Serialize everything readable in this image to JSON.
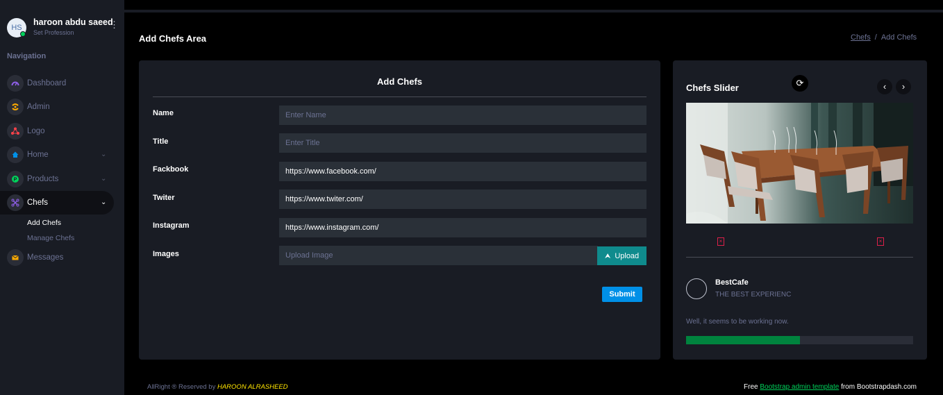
{
  "profile": {
    "initials": "HS",
    "name": "haroon abdu saeed",
    "role": "Set Profession"
  },
  "sidebar": {
    "heading": "Navigation",
    "items": [
      {
        "label": "Dashboard",
        "icon": "speedometer-icon",
        "color": "#8f5fe8"
      },
      {
        "label": "Admin",
        "icon": "admin-icon",
        "color": "#ffab00"
      },
      {
        "label": "Logo",
        "icon": "logo-icon",
        "color": "#fc424a"
      },
      {
        "label": "Home",
        "icon": "home-icon",
        "color": "#0090e7",
        "arrow": "⌄"
      },
      {
        "label": "Products",
        "icon": "products-icon",
        "color": "#00d25b",
        "arrow": "⌄"
      },
      {
        "label": "Chefs",
        "icon": "chefs-icon",
        "color": "#8f5fe8",
        "arrow": "⌄"
      },
      {
        "label": "Messages",
        "icon": "mail-icon",
        "color": "#ffab00"
      }
    ],
    "subitems": [
      "Add Chefs",
      "Manage Chefs"
    ]
  },
  "header": {
    "title": "Add Chefs Area",
    "breadcrumb_link": "Chefs",
    "breadcrumb_sep": "/",
    "breadcrumb_current": "Add Chefs"
  },
  "form": {
    "title": "Add Chefs",
    "fields": [
      {
        "label": "Name",
        "placeholder": "Enter Name",
        "value": ""
      },
      {
        "label": "Title",
        "placeholder": "Enter Title",
        "value": ""
      },
      {
        "label": "Fackbook",
        "placeholder": "",
        "value": "https://www.facebook.com/"
      },
      {
        "label": "Twiter",
        "placeholder": "",
        "value": "https://www.twiter.com/"
      },
      {
        "label": "Instagram",
        "placeholder": "",
        "value": "https://www.instagram.com/"
      },
      {
        "label": "Images",
        "placeholder": "Upload Image",
        "value": ""
      }
    ],
    "upload_label": "Upload",
    "submit_label": "Submit"
  },
  "slider": {
    "title": "Chefs Slider",
    "prev": "‹",
    "next": "›",
    "brand_name": "BestCafe",
    "brand_tagline": "THE BEST EXPERIENC",
    "status_text": "Well, it seems to be working now.",
    "progress": 0.5
  },
  "footer": {
    "left_text": "AllRight ® Reserved by ",
    "author": "HAROON ALRASHEED",
    "right_prefix": "Free ",
    "right_link": "Bootstrap admin template",
    "right_suffix": " from Bootstrapdash.com"
  }
}
